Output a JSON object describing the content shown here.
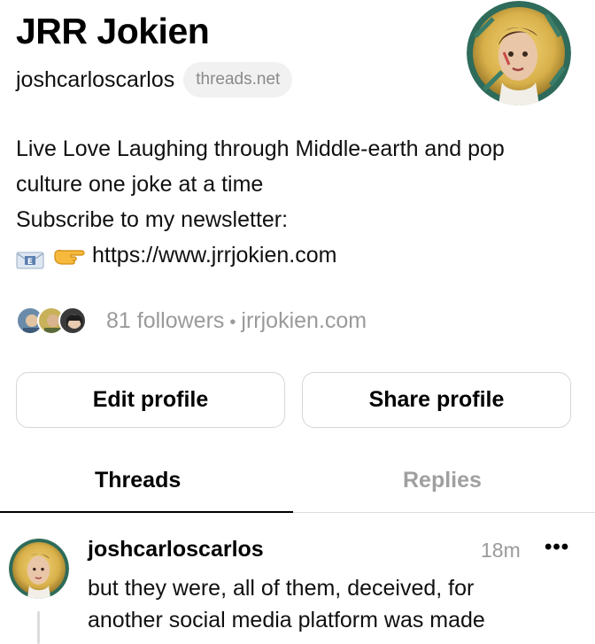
{
  "profile": {
    "display_name": "JRR Jokien",
    "handle": "joshcarloscarlos",
    "domain_chip": "threads.net",
    "bio_lines": [
      "Live Love Laughing through Middle-earth and pop",
      "culture one joke at a time",
      "Subscribe to my newsletter:"
    ],
    "link_url": "https://www.jrrjokien.com",
    "followers_text": "81 followers",
    "website_text": "jrrjokien.com",
    "separator": "•"
  },
  "buttons": {
    "edit_profile": "Edit profile",
    "share_profile": "Share profile"
  },
  "tabs": [
    {
      "label": "Threads",
      "active": true
    },
    {
      "label": "Replies",
      "active": false
    }
  ],
  "post": {
    "username": "joshcarloscarlos",
    "timestamp": "18m",
    "more_glyph": "•••",
    "text_lines": [
      "but they were, all of them, deceived, for",
      "another social media platform was made"
    ]
  },
  "icons": {
    "avatar": "portrait-avatar-icon",
    "envelope": "envelope-emoji-icon",
    "pointing_hand": "pointing-right-hand-emoji-icon",
    "more": "more-options-icon"
  },
  "colors": {
    "text_primary": "#101010",
    "text_secondary": "#9a9a9a",
    "border": "#d6d6d6",
    "chip_bg": "#f1f1f1",
    "halo_gold": "#d8b04a"
  }
}
